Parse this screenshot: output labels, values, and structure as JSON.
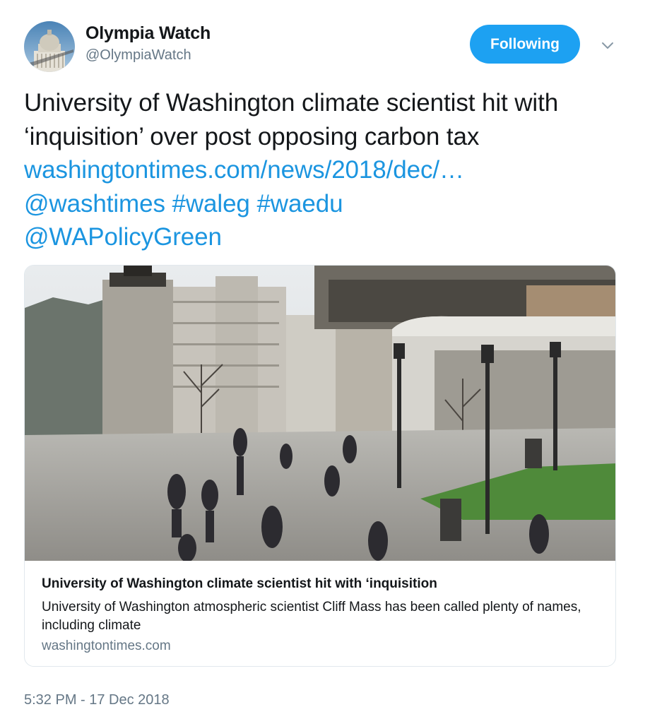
{
  "account": {
    "display_name": "Olympia Watch",
    "handle": "@OlympiaWatch",
    "avatar_icon": "capitol-dome-avatar"
  },
  "follow_button": {
    "label": "Following",
    "color": "#1da1f2"
  },
  "menu_icon": "chevron-down-icon",
  "tweet": {
    "text_plain": "University of Washington climate scientist hit with ‘inquisition’ over post opposing carbon tax",
    "link": "washingtontimes.com/news/2018/dec/…",
    "mention1": "@washtimes",
    "hashtag1": "#waleg",
    "hashtag2": "#waedu",
    "mention2": "@WAPolicyGreen",
    "link_color": "#1b95e0"
  },
  "card": {
    "image_desc_icon": "campus-photo",
    "title": "University of Washington climate scientist hit with ‘inquisition",
    "description": "University of Washington atmospheric scientist Cliff Mass has been called plenty of names, including climate",
    "domain": "washingtontimes.com"
  },
  "timestamp": "5:32 PM - 17 Dec 2018"
}
